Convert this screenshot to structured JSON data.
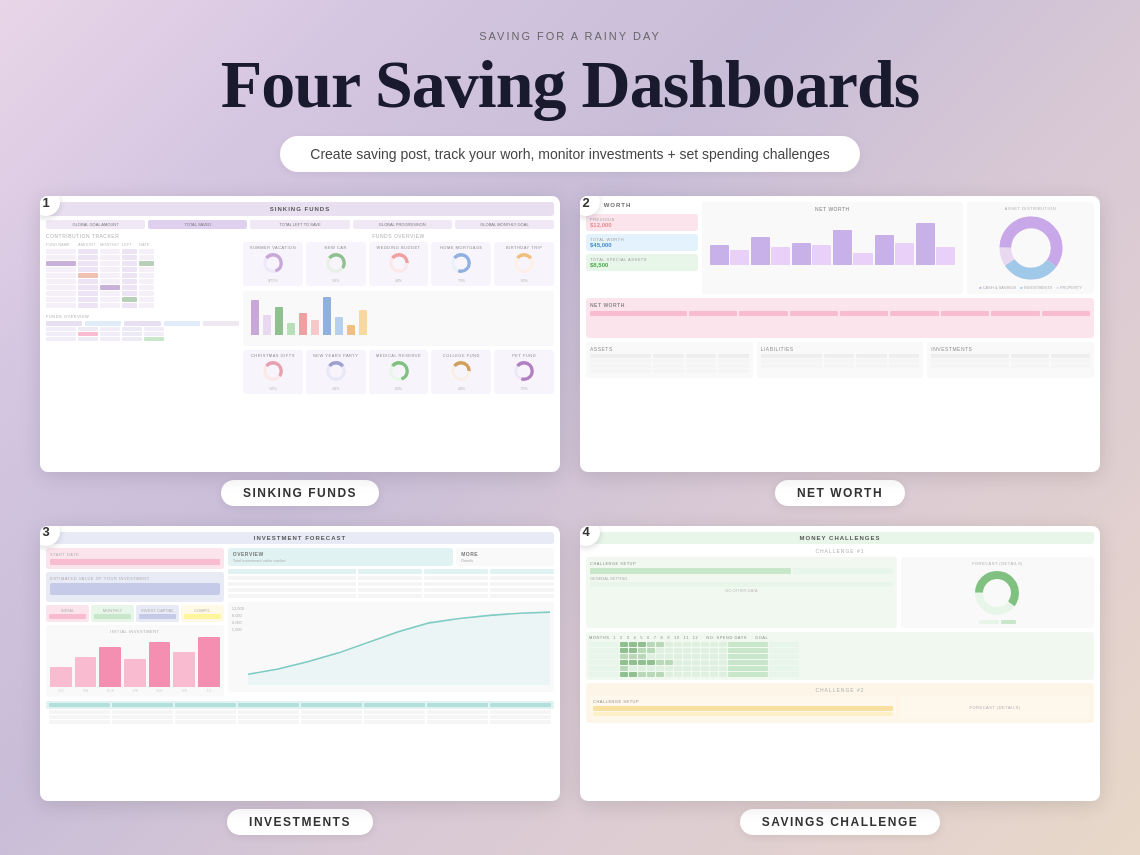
{
  "header": {
    "subtitle": "SAVING FOR A RAINY DAY",
    "title": "Four Saving Dashboards",
    "description": "Create saving post, track your worh, monitor investments + set spending challenges"
  },
  "dashboards": [
    {
      "id": 1,
      "badge": "1",
      "label": "SINKING FUNDS",
      "preview_title": "SINKING FUNDS"
    },
    {
      "id": 2,
      "badge": "2",
      "label": "NET WORTH",
      "preview_title": "NET WORTH"
    },
    {
      "id": 3,
      "badge": "3",
      "label": "INVESTMENTS",
      "preview_title": "INVESTMENT FORECAST"
    },
    {
      "id": 4,
      "badge": "4",
      "label": "SAVINGS CHALLENGE",
      "preview_title": "MONEY CHALLENGES"
    }
  ]
}
